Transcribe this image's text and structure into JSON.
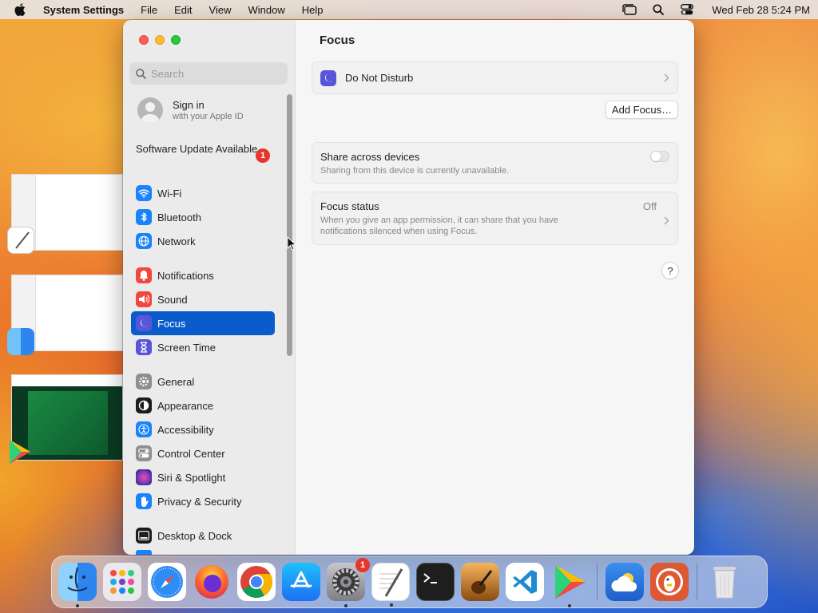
{
  "menubar": {
    "app_name": "System Settings",
    "menus": [
      "File",
      "Edit",
      "View",
      "Window",
      "Help"
    ],
    "clock": "Wed Feb 28  5:24 PM"
  },
  "search": {
    "placeholder": "Search"
  },
  "account": {
    "title": "Sign in",
    "subtitle": "with your Apple ID"
  },
  "software_update": {
    "label": "Software Update Available",
    "badge": "1"
  },
  "sidebar": {
    "groups": [
      [
        {
          "label": "Wi-Fi",
          "icon": "wifi-icon",
          "color": "#1a82fb"
        },
        {
          "label": "Bluetooth",
          "icon": "bluetooth-icon",
          "color": "#1a82fb"
        },
        {
          "label": "Network",
          "icon": "globe-icon",
          "color": "#1a82fb"
        }
      ],
      [
        {
          "label": "Notifications",
          "icon": "bell-icon",
          "color": "#f0473e"
        },
        {
          "label": "Sound",
          "icon": "speaker-icon",
          "color": "#f0473e"
        },
        {
          "label": "Focus",
          "icon": "moon-icon",
          "color": "#5856d6",
          "selected": true
        },
        {
          "label": "Screen Time",
          "icon": "hourglass-icon",
          "color": "#5856d6"
        }
      ],
      [
        {
          "label": "General",
          "icon": "gear-icon",
          "color": "#8e8e93"
        },
        {
          "label": "Appearance",
          "icon": "appearance-icon",
          "color": "#1c1c1e"
        },
        {
          "label": "Accessibility",
          "icon": "accessibility-icon",
          "color": "#1a82fb"
        },
        {
          "label": "Control Center",
          "icon": "control-center-icon",
          "color": "#8e8e93"
        },
        {
          "label": "Siri & Spotlight",
          "icon": "siri-icon",
          "color": "#7a3cc9"
        },
        {
          "label": "Privacy & Security",
          "icon": "hand-icon",
          "color": "#1a82fb"
        }
      ],
      [
        {
          "label": "Desktop & Dock",
          "icon": "dock-icon",
          "color": "#1c1c1e"
        }
      ]
    ]
  },
  "content": {
    "title": "Focus",
    "do_not_disturb": "Do Not Disturb",
    "add_focus": "Add Focus…",
    "share": {
      "title": "Share across devices",
      "subtitle": "Sharing from this device is currently unavailable."
    },
    "focus_status": {
      "title": "Focus status",
      "subtitle": "When you give an app permission, it can share that you have notifications silenced when using Focus.",
      "value": "Off"
    },
    "help": "?"
  },
  "dock": {
    "apps": [
      {
        "name": "Finder",
        "icon": "finder-icon",
        "color": "#3a8ef6",
        "running": true
      },
      {
        "name": "Launchpad",
        "icon": "launchpad-icon",
        "color": "#e9e9ee"
      },
      {
        "name": "Safari",
        "icon": "safari-icon",
        "color": "#2f8cf5"
      },
      {
        "name": "Firefox",
        "icon": "firefox-icon",
        "color": "#6a2dd6"
      },
      {
        "name": "Chrome",
        "icon": "chrome-icon",
        "color": "#ffffff"
      },
      {
        "name": "App Store",
        "icon": "app-store-icon",
        "color": "#1d86f7"
      },
      {
        "name": "System Settings",
        "icon": "settings-icon",
        "color": "#8e8e93",
        "badge": "1",
        "running": true
      },
      {
        "name": "TextEdit",
        "icon": "textedit-icon",
        "color": "#ffffff",
        "running": true
      },
      {
        "name": "Terminal",
        "icon": "terminal-icon",
        "color": "#1e1e1e"
      },
      {
        "name": "GarageBand",
        "icon": "garageband-icon",
        "color": "#f09a3a"
      },
      {
        "name": "VS Code",
        "icon": "vscode-icon",
        "color": "#ffffff"
      },
      {
        "name": "Play Store",
        "icon": "play-store-icon",
        "color": "#ffffff",
        "running": true
      },
      {
        "name": "Weather",
        "icon": "weather-icon",
        "color": "#2e7fe3"
      },
      {
        "name": "DuckDuckGo",
        "icon": "duckduckgo-icon",
        "color": "#de5833"
      },
      {
        "name": "Trash",
        "icon": "trash-icon",
        "color": "#e8e8ea"
      }
    ]
  }
}
